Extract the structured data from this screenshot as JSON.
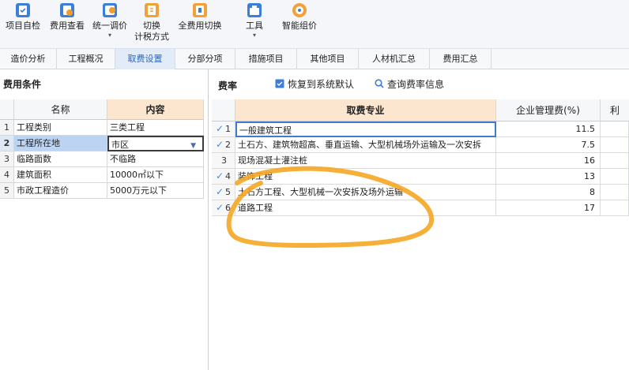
{
  "toolbar": {
    "buttons": [
      {
        "label": "项目自检",
        "sub": "",
        "caret": ""
      },
      {
        "label": "费用查看",
        "sub": "",
        "caret": ""
      },
      {
        "label": "统一调价",
        "sub": "",
        "caret": "▾"
      },
      {
        "label": "切换",
        "sub": "计税方式",
        "caret": ""
      },
      {
        "label": "全费用切换",
        "sub": "",
        "caret": ""
      },
      {
        "label": "工具",
        "sub": "",
        "caret": "▾"
      },
      {
        "label": "智能组价",
        "sub": "",
        "caret": ""
      }
    ]
  },
  "tabs": [
    "造价分析",
    "工程概况",
    "取费设置",
    "分部分项",
    "措施项目",
    "其他项目",
    "人材机汇总",
    "费用汇总"
  ],
  "active_tab": "取费设置",
  "left_panel": {
    "title": "费用条件",
    "columns": {
      "name": "名称",
      "content": "内容"
    },
    "rows": [
      {
        "num": "1",
        "name": "工程类别",
        "value": "三类工程"
      },
      {
        "num": "2",
        "name": "工程所在地",
        "value": "市区"
      },
      {
        "num": "3",
        "name": "临路面数",
        "value": "不临路"
      },
      {
        "num": "4",
        "name": "建筑面积",
        "value": "10000㎡以下"
      },
      {
        "num": "5",
        "name": "市政工程造价",
        "value": "5000万元以下"
      }
    ]
  },
  "right_panel": {
    "title": "费率",
    "restore_label": "恢复到系统默认",
    "query_label": "查询费率信息",
    "columns": {
      "profession": "取费专业",
      "mgmt_fee": "企业管理费(%)",
      "extra": "利"
    },
    "rows": [
      {
        "num": "1",
        "checked": "✓",
        "profession": "一般建筑工程",
        "fee": "11.5"
      },
      {
        "num": "2",
        "checked": "✓",
        "profession": "土石方、建筑物超高、垂直运输、大型机械场外运输及一次安拆",
        "fee": "7.5"
      },
      {
        "num": "3",
        "checked": "",
        "profession": "现场混凝土灌注桩",
        "fee": "16"
      },
      {
        "num": "4",
        "checked": "✓",
        "profession": "装饰工程",
        "fee": "13"
      },
      {
        "num": "5",
        "checked": "✓",
        "profession": "土石方工程、大型机械一次安拆及场外运输",
        "fee": "8"
      },
      {
        "num": "6",
        "checked": "✓",
        "profession": "道路工程",
        "fee": "17"
      }
    ]
  },
  "colors": {
    "accent": "#3d7bd4",
    "header_highlight": "#fce6cf",
    "scribble": "#f5a623"
  }
}
